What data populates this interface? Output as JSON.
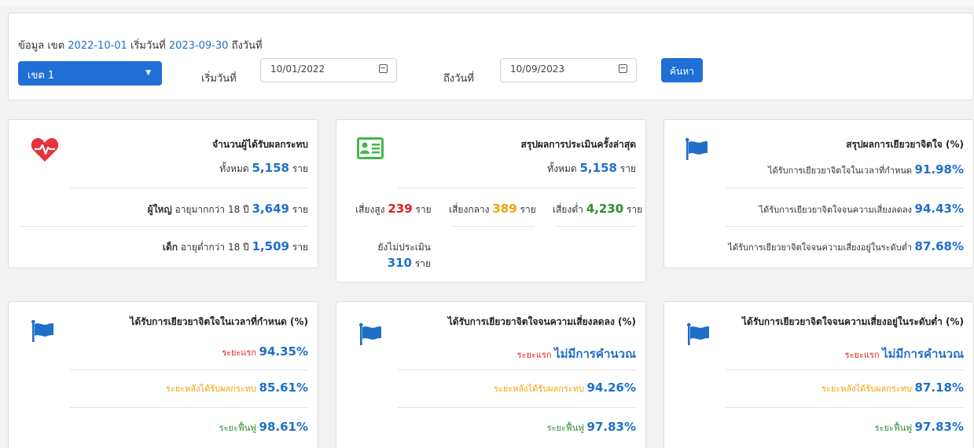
{
  "filter": {
    "summary_prefix": "ข้อมูล เขต",
    "summary_date_from": "2022-10-01",
    "summary_mid": "เริ่มวันที่",
    "summary_date_to": "2023-09-30",
    "summary_suffix": "ถึงวันที่",
    "region_selected": "เขต 1",
    "start_label": "เริ่มวันที่",
    "start_value": "10/01/2022",
    "end_label": "ถึงวันที่",
    "end_value": "10/09/2023",
    "search_label": "ค้นหา"
  },
  "card_affected": {
    "title": "จำนวนผู้ได้รับผลกระทบ",
    "total_label": "ทั้งหมด",
    "total_value": "5,158",
    "unit": "ราย",
    "adult_label": "ผู้ใหญ่",
    "adult_desc": "อายุมากกว่า 18 ปี",
    "adult_value": "3,649",
    "child_label": "เด็ก",
    "child_desc": "อายุต่ำกว่า 18 ปี",
    "child_value": "1,509"
  },
  "card_assessment": {
    "title": "สรุปผลการประเมินครั้งล่าสุด",
    "total_label": "ทั้งหมด",
    "total_value": "5,158",
    "unit": "ราย",
    "high_label": "เสี่ยงสูง",
    "high_value": "239",
    "mid_label": "เสี่ยงกลาง",
    "mid_value": "389",
    "low_label": "เสี่ยงต่ำ",
    "low_value": "4,230",
    "none_label": "ยังไม่ประเมิน",
    "none_value": "310"
  },
  "card_healing": {
    "title": "สรุปผลการเยียวยาจิตใจ (%)",
    "r1_label": "ได้รับการเยียวยาจิตใจในเวลาที่กำหนด",
    "r1_value": "91.98%",
    "r2_label": "ได้รับการเยียวยาจิตใจจนความเสี่ยงลดลง",
    "r2_value": "94.43%",
    "r3_label": "ได้รับการเยียวยาจิตใจจนความเสี่ยงอยู่ในระดับต่ำ",
    "r3_value": "87.68%"
  },
  "card_ontime": {
    "title": "ได้รับการเยียวยาจิตใจในเวลาที่กำหนด (%)",
    "phase1_label": "ระยะแรก",
    "phase1_value": "94.35%",
    "phase2_label": "ระยะหลังได้รับผลกระทบ",
    "phase2_value": "85.61%",
    "phase3_label": "ระยะฟื้นฟู",
    "phase3_value": "98.61%"
  },
  "card_reduced": {
    "title": "ได้รับการเยียวยาจิตใจจนความเสี่ยงลดลง (%)",
    "phase1_label": "ระยะแรก",
    "phase1_value": "ไม่มีการคำนวณ",
    "phase2_label": "ระยะหลังได้รับผลกระทบ",
    "phase2_value": "94.26%",
    "phase3_label": "ระยะฟื้นฟู",
    "phase3_value": "97.83%"
  },
  "card_low": {
    "title": "ได้รับการเยียวยาจิตใจจนความเสี่ยงอยู่ในระดับต่ำ (%)",
    "phase1_label": "ระยะแรก",
    "phase1_value": "ไม่มีการคำนวณ",
    "phase2_label": "ระยะหลังได้รับผลกระทบ",
    "phase2_value": "87.18%",
    "phase3_label": "ระยะฟื้นฟู",
    "phase3_value": "97.83%"
  },
  "icons": {
    "heart": "heart-pulse-icon",
    "id_card": "id-card-icon",
    "flag": "flag-icon"
  },
  "colors": {
    "primary": "#1f6fd6",
    "value_blue": "#1f6fc9",
    "risk_high": "#e31b1b",
    "risk_mid": "#f0a20a",
    "risk_low": "#2e8b2e",
    "heart": "#e8323c",
    "id_card": "#44b649"
  }
}
